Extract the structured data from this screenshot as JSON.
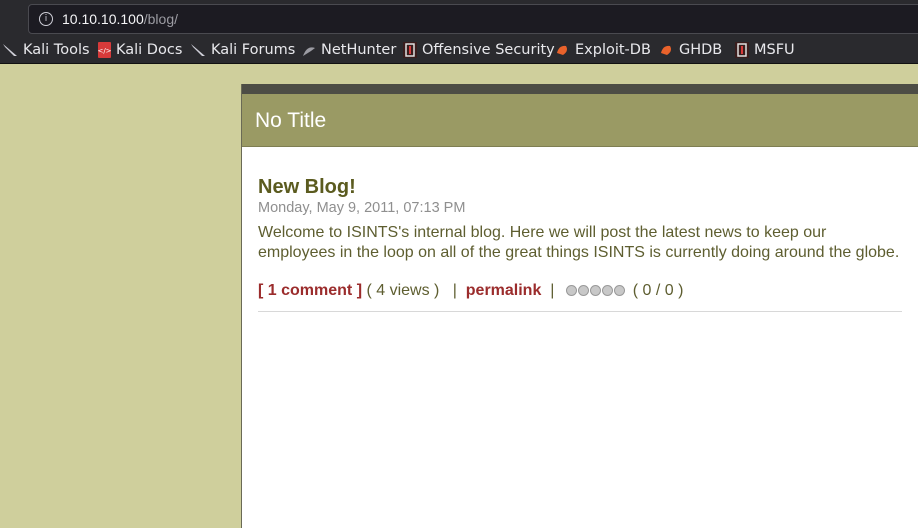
{
  "browser": {
    "url_host": "10.10.10.100",
    "url_path": "/blog/",
    "bookmarks": [
      {
        "label": "Kali Tools",
        "icon": "kali-dragon-icon"
      },
      {
        "label": "Kali Docs",
        "icon": "kali-docs-icon"
      },
      {
        "label": "Kali Forums",
        "icon": "kali-dragon-icon"
      },
      {
        "label": "NetHunter",
        "icon": "nethunter-icon"
      },
      {
        "label": "Offensive Security",
        "icon": "offsec-icon"
      },
      {
        "label": "Exploit-DB",
        "icon": "exploit-db-icon"
      },
      {
        "label": "GHDB",
        "icon": "ghdb-icon"
      },
      {
        "label": "MSFU",
        "icon": "offsec-icon"
      }
    ]
  },
  "page": {
    "title": "No Title"
  },
  "post": {
    "title": "New Blog!",
    "date": "Monday, May 9, 2011, 07:13 PM",
    "body": "Welcome to ISINTS's internal blog. Here we will post the latest news to keep our employees in the loop on all of the great things ISINTS is currently doing around the globe.",
    "comments_link": "[ 1 comment ]",
    "views": "( 4 views )",
    "separator": "|",
    "permalink": "permalink",
    "rating": "( 0 / 0 )",
    "rating_stars": 0,
    "rating_max": 5
  },
  "colors": {
    "sidebar_bg": "#cfcf9c",
    "title_bar_bg": "#9a9a64",
    "link": "#9b2c2c",
    "post_title": "#5b5b1f"
  }
}
